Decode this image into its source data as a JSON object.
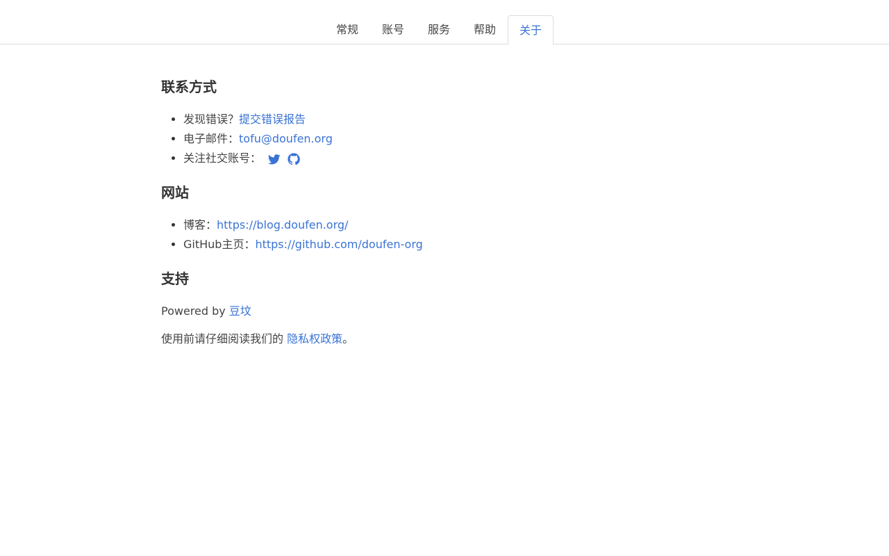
{
  "tabs": [
    {
      "label": "常规",
      "active": false
    },
    {
      "label": "账号",
      "active": false
    },
    {
      "label": "服务",
      "active": false
    },
    {
      "label": "帮助",
      "active": false
    },
    {
      "label": "关于",
      "active": true
    }
  ],
  "contact": {
    "heading": "联系方式",
    "bug_prefix": "发现错误？",
    "bug_link": "提交错误报告",
    "email_prefix": "电子邮件：",
    "email_link": "tofu@doufen.org",
    "social_prefix": "关注社交账号：",
    "social_icons": [
      "twitter-icon",
      "github-icon"
    ]
  },
  "website": {
    "heading": "网站",
    "blog_prefix": "博客：",
    "blog_link": "https://blog.doufen.org/",
    "github_prefix": "GitHub主页：",
    "github_link": "https://github.com/doufen-org"
  },
  "support": {
    "heading": "支持",
    "powered_prefix": "Powered by ",
    "powered_link": "豆坟",
    "privacy_prefix": "使用前请仔细阅读我们的 ",
    "privacy_link": "隐私权政策",
    "privacy_suffix": "。"
  },
  "colors": {
    "link": "#3a73d6",
    "text": "#444444",
    "border": "#dddddd"
  }
}
